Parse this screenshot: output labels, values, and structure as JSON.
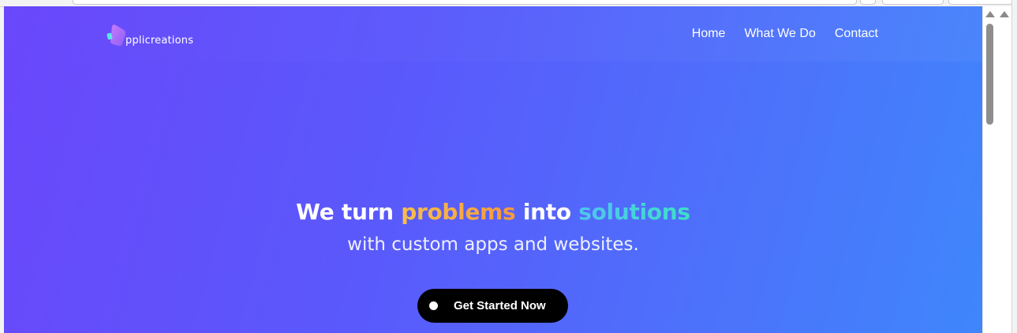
{
  "brand": {
    "logo_text": "pplicreations",
    "colors": {
      "gradient_start": "#6a47fb",
      "gradient_end": "#3f86fb",
      "problems": "#f5a93f",
      "solutions": "#3fd6d0",
      "cta_bg": "#000000"
    }
  },
  "nav": {
    "items": [
      {
        "label": "Home"
      },
      {
        "label": "What We Do"
      },
      {
        "label": "Contact"
      }
    ]
  },
  "hero": {
    "title_part1": "We turn ",
    "title_highlight1": "problems",
    "title_part2": " into ",
    "title_highlight2": "solutions",
    "subtitle": "with custom apps and websites.",
    "cta_label": "Get Started Now"
  },
  "icons": {
    "logo": "logo-mark-icon",
    "cta_dot": "dot-icon",
    "scroll_up": "scroll-up-arrow-icon"
  }
}
